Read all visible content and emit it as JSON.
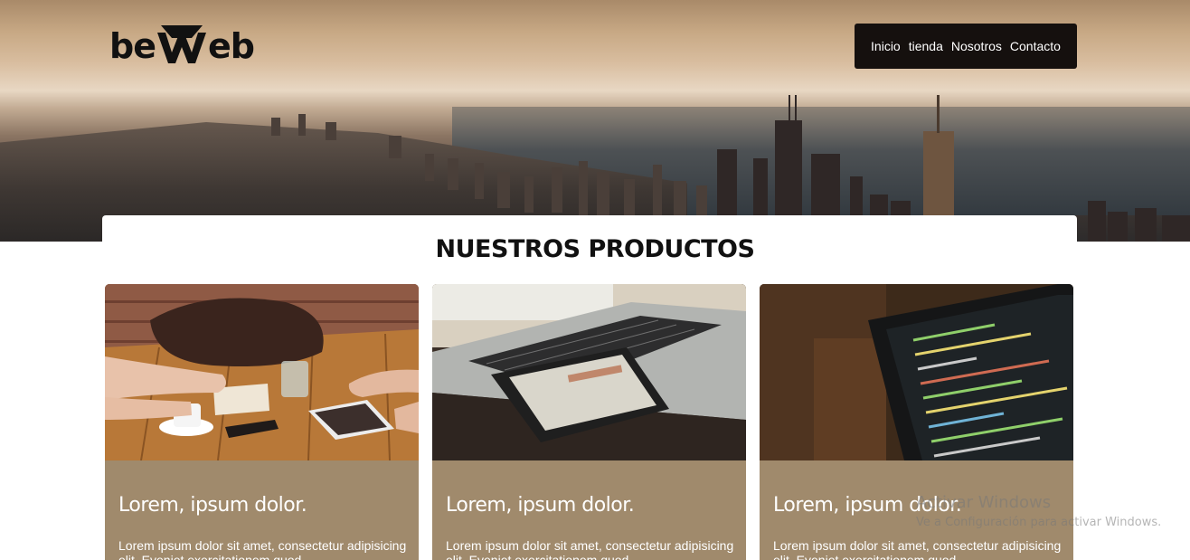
{
  "logo": {
    "text_left": "be",
    "text_right": "eb"
  },
  "nav": {
    "items": [
      "Inicio",
      "tienda",
      "Nosotros",
      "Contacto"
    ]
  },
  "section": {
    "title": "NUESTROS PRODUCTOS"
  },
  "products": [
    {
      "title": "Lorem, ipsum dolor.",
      "description": "Lorem ipsum dolor sit amet, consectetur adipisicing elit. Eveniet exercitationem quod",
      "image": "meeting-table-photo"
    },
    {
      "title": "Lorem, ipsum dolor.",
      "description": "Lorem ipsum dolor sit amet, consectetur adipisicing elit. Eveniet exercitationem quod",
      "image": "phone-laptop-photo"
    },
    {
      "title": "Lorem, ipsum dolor.",
      "description": "Lorem ipsum dolor sit amet, consectetur adipisicing elit. Eveniet exercitationem quod",
      "image": "code-laptop-photo"
    }
  ],
  "watermark": {
    "line1": "Activar Windows",
    "line2": "Ve a Configuración para activar Windows."
  },
  "colors": {
    "card_bg": "#a08a6c",
    "nav_bg": "#15100e"
  }
}
